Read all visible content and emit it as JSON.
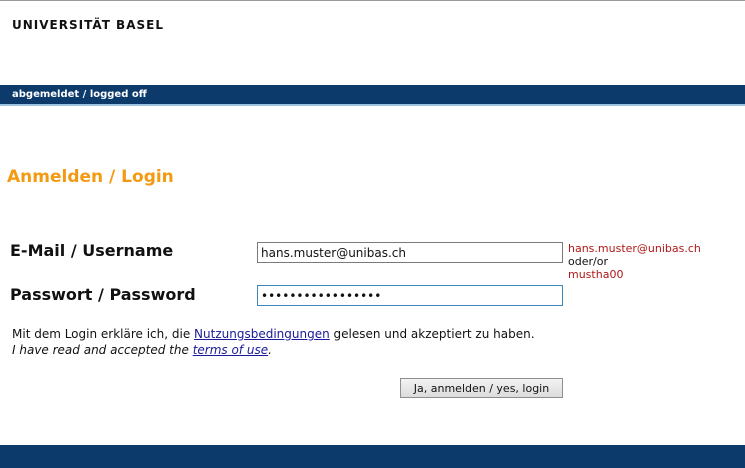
{
  "header": {
    "logo_text": "UNIVERSITÄT BASEL"
  },
  "status_bar": {
    "text": "abgemeldet / logged off",
    "color": "#0c3a6b"
  },
  "main": {
    "title": "Anmelden / Login",
    "username_label": "E-Mail / Username",
    "username_value": "hans.muster@unibas.ch",
    "password_label": "Passwort / Password",
    "password_value": "•••••••••••••••••",
    "hint": {
      "line1": "hans.muster@unibas.ch",
      "line2": "oder/or",
      "line3": "mustha00"
    },
    "terms": {
      "de_prefix": "Mit dem Login erkläre ich, die ",
      "de_link": "Nutzungsbedingungen",
      "de_suffix": " gelesen und akzeptiert zu haben.",
      "en_prefix": "I have read and accepted the ",
      "en_link": "terms of use",
      "en_suffix": "."
    },
    "login_button": "Ja, anmelden / yes, login"
  },
  "colors": {
    "accent": "#f39a12",
    "brand": "#0c3a6b",
    "hint": "#b01818"
  }
}
